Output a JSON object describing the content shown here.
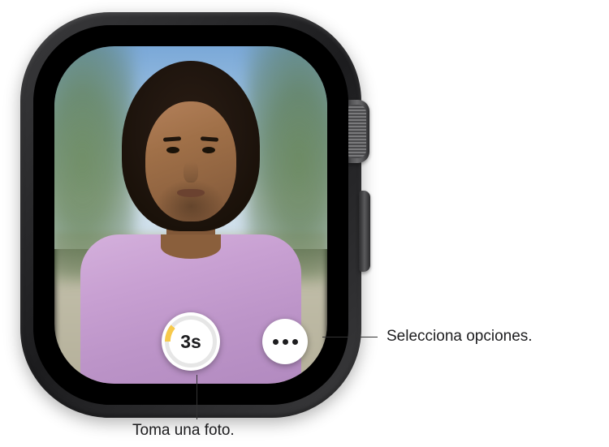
{
  "camera": {
    "timer_label": "3s"
  },
  "callouts": {
    "options": "Selecciona opciones.",
    "shutter": "Toma una foto."
  }
}
